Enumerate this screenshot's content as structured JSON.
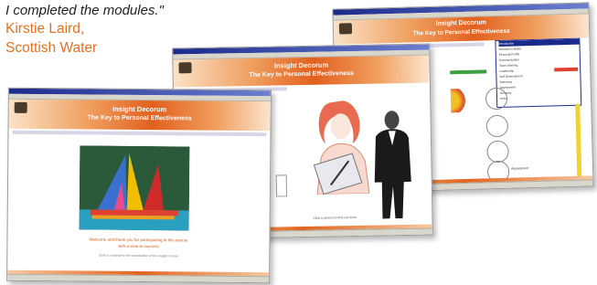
{
  "quote": {
    "text": "I completed the modules.\"",
    "name": "Kirstie Laird,",
    "company": "Scottish Water"
  },
  "screens": {
    "front": {
      "banner_title": "Insight Decorum",
      "banner_subtitle": "The Key to Personal Effectiveness",
      "body_line1": "Welcome and thank you for participating in this course",
      "body_line2": "with a view to success",
      "body_line3": "Click to continue to the introduction of the Insight course"
    },
    "middle": {
      "banner_title": "Insight Decorum",
      "banner_subtitle": "The Key to Personal Effectiveness",
      "caption": "Click a person to find out more"
    },
    "back": {
      "banner_title": "Insight Decorum",
      "banner_subtitle": "The Key to Personal Effectiveness",
      "menu_items": [
        "Introduction",
        "Interaction Styles",
        "Personal Profile",
        "Communication",
        "Team Working",
        "Leadership",
        "Self Development",
        "Summary",
        "Assessment",
        "Glossary",
        "Help"
      ],
      "circle_label": "Assessment"
    }
  },
  "colors": {
    "accent": "#e6711e",
    "titlebar": "#1a2a8a",
    "chrome": "#d9d6cc"
  }
}
